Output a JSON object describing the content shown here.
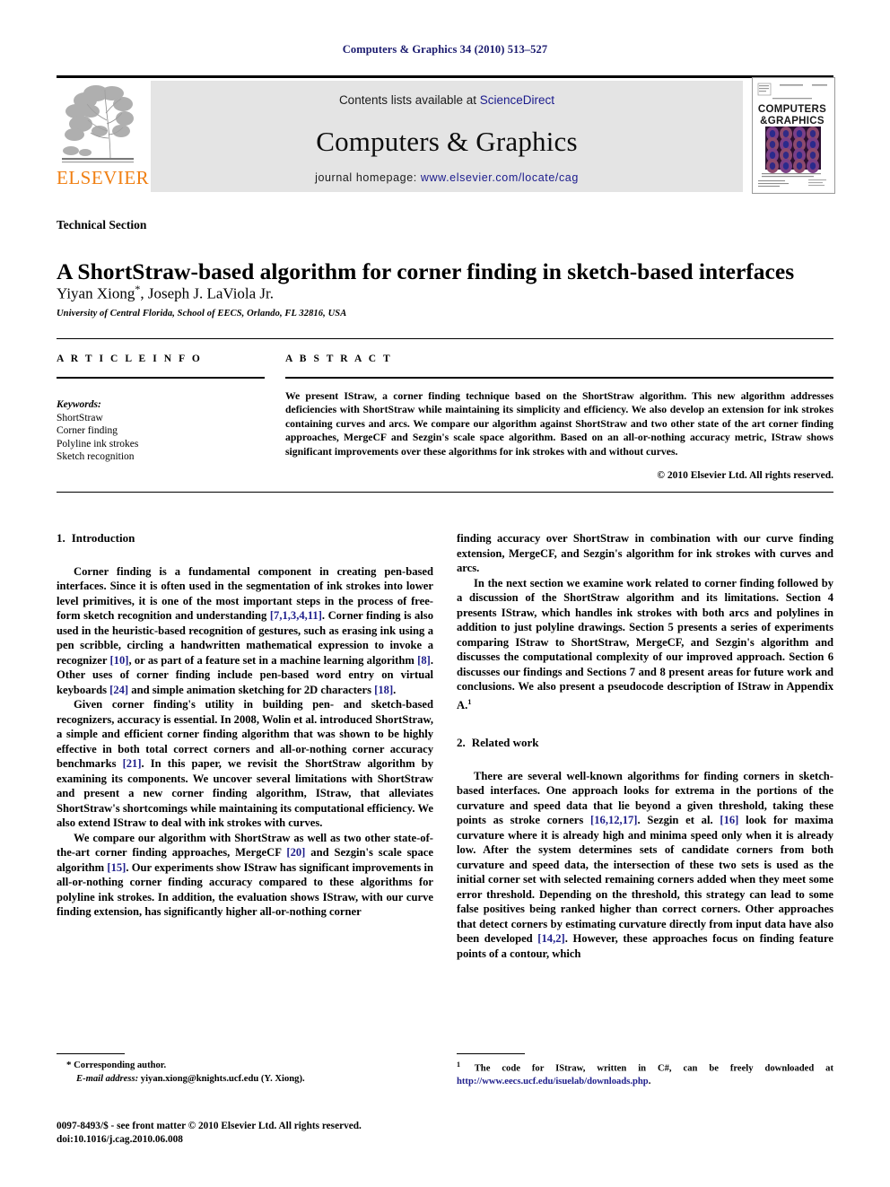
{
  "running_head": "Computers & Graphics 34 (2010) 513–527",
  "masthead": {
    "publisher_name": "ELSEVIER",
    "contents_prefix": "Contents lists available at ",
    "contents_link": "ScienceDirect",
    "journal_title": "Computers & Graphics",
    "homepage_prefix": "journal homepage: ",
    "homepage_link": "www.elsevier.com/locate/cag",
    "cover_title_line1": "COMPUTERS",
    "cover_title_line2": "&GRAPHICS",
    "colors": {
      "elsevier_orange": "#F07F12",
      "link_blue": "#1a1a8c",
      "banner_gray": "#e4e4e4",
      "running_head_blue": "#1a1a6e",
      "citation_blue": "#20208c"
    }
  },
  "article": {
    "section_label": "Technical Section",
    "title": "A ShortStraw-based algorithm for corner finding in sketch-based interfaces",
    "authors": "Yiyan Xiong",
    "authors_rest": ", Joseph J. LaViola Jr.",
    "author_marker": "*",
    "affiliation": "University of Central Florida, School of EECS, Orlando, FL 32816, USA"
  },
  "info": {
    "heading": "A R T I C L E   I N F O",
    "keywords_label": "Keywords:",
    "keywords": [
      "ShortStraw",
      "Corner finding",
      "Polyline ink strokes",
      "Sketch recognition"
    ]
  },
  "abstract": {
    "heading": "A B S T R A C T",
    "text": "We present IStraw, a corner finding technique based on the ShortStraw algorithm. This new algorithm addresses deficiencies with ShortStraw while maintaining its simplicity and efficiency. We also develop an extension for ink strokes containing curves and arcs. We compare our algorithm against ShortStraw and two other state of the art corner finding approaches, MergeCF and Sezgin's scale space algorithm. Based on an all-or-nothing accuracy metric, IStraw shows significant improvements over these algorithms for ink strokes with and without curves.",
    "copyright": "© 2010 Elsevier Ltd. All rights reserved."
  },
  "sections": {
    "intro": {
      "number": "1.",
      "title": "Introduction",
      "p1_a": "Corner finding is a fundamental component in creating pen-based interfaces. Since it is often used in the segmentation of ink strokes into lower level primitives, it is one of the most important steps in the process of free-form sketch recognition and understanding ",
      "p1_c1": "[7,1,3,4,11]",
      "p1_b": ". Corner finding is also used in the heuristic-based recognition of gestures, such as erasing ink using a pen scribble, circling a handwritten mathematical expression to invoke a recognizer ",
      "p1_c2": "[10]",
      "p1_c": ", or as part of a feature set in a machine learning algorithm ",
      "p1_c3": "[8]",
      "p1_d": ". Other uses of corner finding include pen-based word entry on virtual keyboards ",
      "p1_c4": "[24]",
      "p1_e": " and simple animation sketching for 2D characters ",
      "p1_c5": "[18]",
      "p1_f": ".",
      "p2_a": "Given corner finding's utility in building pen- and sketch-based recognizers, accuracy is essential. In 2008, Wolin et al. introduced ShortStraw, a simple and efficient corner finding algorithm that was shown to be highly effective in both total correct corners and all-or-nothing corner accuracy benchmarks ",
      "p2_c1": "[21]",
      "p2_b": ". In this paper, we revisit the ShortStraw algorithm by examining its components. We uncover several limitations with ShortStraw and present a new corner finding algorithm, IStraw, that alleviates ShortStraw's shortcomings while maintaining its computational efficiency. We also extend IStraw to deal with ink strokes with curves.",
      "p3_a": "We compare our algorithm with ShortStraw as well as two other state-of-the-art corner finding approaches, MergeCF ",
      "p3_c1": "[20]",
      "p3_b": " and Sezgin's scale space algorithm ",
      "p3_c2": "[15]",
      "p3_c": ". Our experiments show IStraw has significant improvements in all-or-nothing corner finding accuracy compared to these algorithms for polyline ink strokes. In addition, the evaluation shows IStraw, with our curve finding extension, has significantly higher all-or-nothing corner",
      "p3_cont": "finding accuracy over ShortStraw in combination with our curve finding extension, MergeCF, and Sezgin's algorithm for ink strokes with curves and arcs.",
      "p4": "In the next section we examine work related to corner finding followed by a discussion of the ShortStraw algorithm and its limitations. Section 4 presents IStraw, which handles ink strokes with both arcs and polylines in addition to just polyline drawings. Section 5 presents a series of experiments comparing IStraw to ShortStraw, MergeCF, and Sezgin's algorithm and discusses the computational complexity of our improved approach. Section 6 discusses our findings and Sections 7 and 8 present areas for future work and conclusions. We also present a pseudocode description of IStraw in Appendix A.",
      "p4_footnote_marker": "1"
    },
    "related": {
      "number": "2.",
      "title": "Related work",
      "p1_a": "There are several well-known algorithms for finding corners in sketch-based interfaces. One approach looks for extrema in the portions of the curvature and speed data that lie beyond a given threshold, taking these points as stroke corners ",
      "p1_c1": "[16,12,17]",
      "p1_b": ". Sezgin et al. ",
      "p1_c2": "[16]",
      "p1_c": " look for maxima curvature where it is already high and minima speed only when it is already low. After the system determines sets of candidate corners from both curvature and speed data, the intersection of these two sets is used as the initial corner set with selected remaining corners added when they meet some error threshold. Depending on the threshold, this strategy can lead to some false positives being ranked higher than correct corners. Other approaches that detect corners by estimating curvature directly from input data have also been developed ",
      "p1_c3": "[14,2]",
      "p1_d": ". However, these approaches focus on finding feature points of a contour, which"
    }
  },
  "footnotes": {
    "left_star": "*",
    "left_corresponding": " Corresponding author.",
    "email_label": "E-mail address:",
    "email_value": " yiyan.xiong@knights.ucf.edu (Y. Xiong).",
    "issn_line1": "0097-8493/$ - see front matter © 2010 Elsevier Ltd. All rights reserved.",
    "issn_line2": "doi:10.1016/j.cag.2010.06.008",
    "right_num": "1",
    "right_text": " The code for IStraw, written in C#, can be freely downloaded at ",
    "right_url": "http://www.eecs.ucf.edu/isuelab/downloads.php",
    "right_tail": "."
  }
}
